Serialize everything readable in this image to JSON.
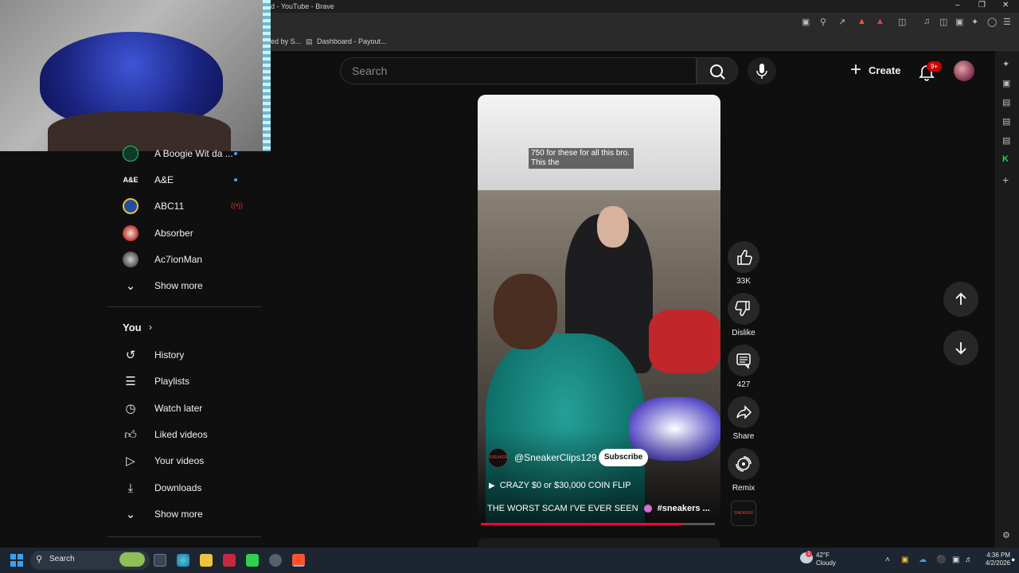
{
  "browser": {
    "title": "d - YouTube - Brave",
    "bookmarks": [
      "ed by S...",
      "Dashboard - Payout..."
    ]
  },
  "header": {
    "search_placeholder": "Search",
    "create_label": "Create",
    "notif_badge": "9+"
  },
  "sidebar": {
    "subscriptions": [
      {
        "label": "A Boogie Wit da ...",
        "badge": "dot"
      },
      {
        "label": "A&E",
        "badge": "dot"
      },
      {
        "label": "ABC11",
        "badge": "live"
      },
      {
        "label": "Absorber",
        "badge": ""
      },
      {
        "label": "Ac7ionMan",
        "badge": ""
      }
    ],
    "show_more_1": "Show more",
    "you_heading": "You",
    "you_items": [
      {
        "label": "History",
        "icon": "history-icon"
      },
      {
        "label": "Playlists",
        "icon": "playlists-icon"
      },
      {
        "label": "Watch later",
        "icon": "watch-later-icon"
      },
      {
        "label": "Liked videos",
        "icon": "liked-icon"
      },
      {
        "label": "Your videos",
        "icon": "your-videos-icon"
      },
      {
        "label": "Downloads",
        "icon": "downloads-icon"
      }
    ],
    "show_more_2": "Show more"
  },
  "short": {
    "caption_line1": "750 for these for all this bro.",
    "caption_line2": "This the",
    "channel_logo_text": "SNEAKER",
    "channel": "@SneakerClips129",
    "subscribe_label": "Subscribe",
    "playlist_title": "CRAZY $0 or $30,000 COIN FLIP",
    "video_title": "THE WORST SCAM I'VE EVER SEEN",
    "hashtag": "#sneakers ...",
    "progress": 0.86
  },
  "actions": {
    "like_count": "33K",
    "dislike_label": "Dislike",
    "comment_count": "427",
    "share_label": "Share",
    "remix_label": "Remix"
  },
  "taskbar": {
    "search_label": "Search",
    "weather_temp": "42°F",
    "weather_desc": "Cloudy",
    "weather_alert": "1",
    "time": "4:36 PM",
    "date": "4/2/2026"
  },
  "colors": {
    "accent": "#ff0033",
    "link": "#3ea6ff",
    "taskbar_bg": "#1c2530"
  }
}
